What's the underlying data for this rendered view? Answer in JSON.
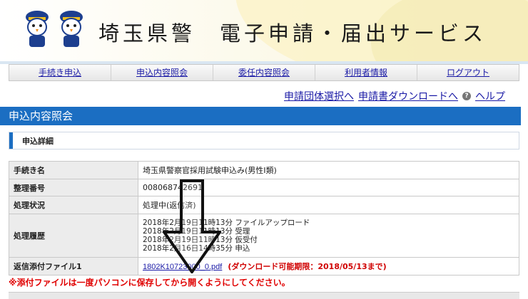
{
  "header": {
    "title": "埼玉県警　電子申請・届出サービス"
  },
  "nav": {
    "items": [
      "手続き申込",
      "申込内容照会",
      "委任内容照会",
      "利用者情報",
      "ログアウト"
    ]
  },
  "subnav": {
    "group_select": "申請団体選択へ",
    "download": "申請書ダウンロードへ",
    "help": "ヘルプ"
  },
  "page_title": "申込内容照会",
  "section_title": "申込詳細",
  "details": {
    "procedure_label": "手続き名",
    "procedure_value": "埼玉県警察官採用試験申込み(男性I類)",
    "number_label": "整理番号",
    "number_value": "008068742691",
    "status_label": "処理状況",
    "status_value": "処理中(返信済)",
    "history_label": "処理履歴",
    "history": [
      "2018年2月19日11時13分 ファイルアップロード",
      "2018年2月19日11時13分 受理",
      "2018年2月19日11時13分 仮受付",
      "2018年2月16日14時35分 申込"
    ],
    "file_label": "返信添付ファイル1",
    "file_name": "1802K10723000_0.pdf",
    "file_deadline": "(ダウンロード可能期限：2018/05/13まで)"
  },
  "notice": "※添付ファイルは一度パソコンに保存してから開くようにしてください。",
  "colors": {
    "accent": "#1b6ec2",
    "warning": "#e00000",
    "link": "#1a1aa6"
  }
}
